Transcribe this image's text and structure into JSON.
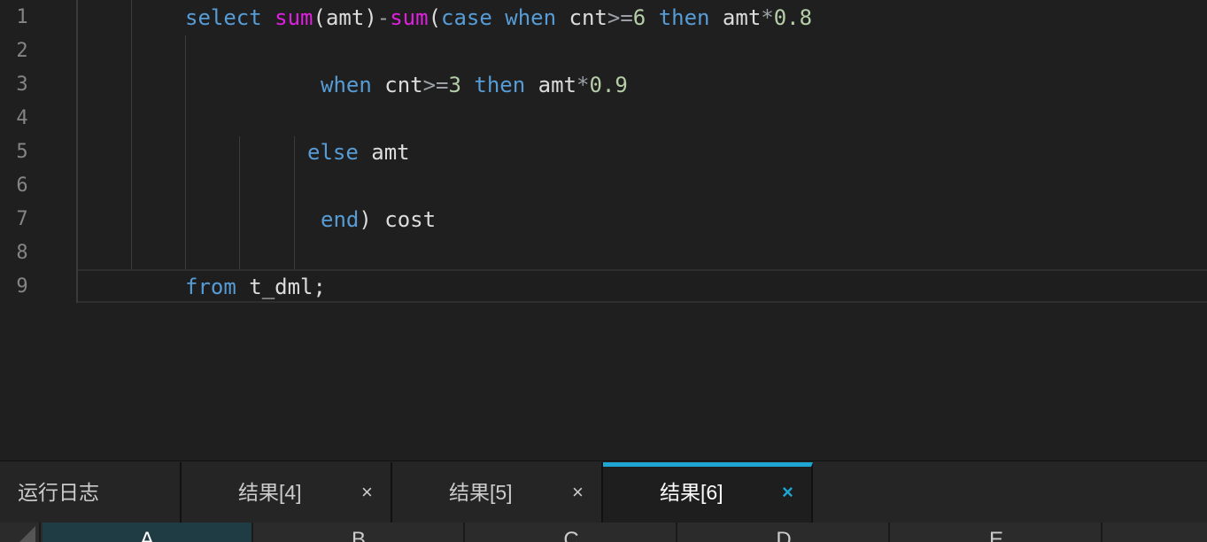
{
  "editor": {
    "line_numbers": [
      "1",
      "2",
      "3",
      "4",
      "5",
      "6",
      "7",
      "8",
      "9"
    ],
    "lines": [
      [
        {
          "t": "select",
          "c": "kw"
        },
        {
          "t": " ",
          "c": "plain"
        },
        {
          "t": "sum",
          "c": "fn"
        },
        {
          "t": "(amt)",
          "c": "plain"
        },
        {
          "t": "-",
          "c": "op"
        },
        {
          "t": "sum",
          "c": "fn"
        },
        {
          "t": "(",
          "c": "plain"
        },
        {
          "t": "case",
          "c": "kw"
        },
        {
          "t": " ",
          "c": "plain"
        },
        {
          "t": "when",
          "c": "kw"
        },
        {
          "t": " cnt",
          "c": "plain"
        },
        {
          "t": ">=",
          "c": "op"
        },
        {
          "t": "6",
          "c": "num"
        },
        {
          "t": " ",
          "c": "plain"
        },
        {
          "t": "then",
          "c": "kw"
        },
        {
          "t": " amt",
          "c": "plain"
        },
        {
          "t": "*",
          "c": "op"
        },
        {
          "t": "0.8",
          "c": "num"
        }
      ],
      [],
      [
        {
          "t": "when",
          "c": "kw"
        },
        {
          "t": " cnt",
          "c": "plain"
        },
        {
          "t": ">=",
          "c": "op"
        },
        {
          "t": "3",
          "c": "num"
        },
        {
          "t": " ",
          "c": "plain"
        },
        {
          "t": "then",
          "c": "kw"
        },
        {
          "t": " amt",
          "c": "plain"
        },
        {
          "t": "*",
          "c": "op"
        },
        {
          "t": "0.9",
          "c": "num"
        }
      ],
      [],
      [
        {
          "t": "else",
          "c": "kw"
        },
        {
          "t": " amt",
          "c": "plain"
        }
      ],
      [],
      [
        {
          "t": "end",
          "c": "kw"
        },
        {
          "t": ") cost",
          "c": "plain"
        }
      ],
      [],
      [
        {
          "t": "from",
          "c": "kw"
        },
        {
          "t": " t_dml;",
          "c": "plain"
        }
      ]
    ]
  },
  "tabs": {
    "log_label": "运行日志",
    "result4_label": "结果[4]",
    "result5_label": "结果[5]",
    "result6_label": "结果[6]",
    "close_glyph": "×"
  },
  "grid": {
    "columns": [
      "A",
      "B",
      "C",
      "D",
      "E"
    ]
  },
  "colors": {
    "keyword": "#569cd6",
    "function": "#e020e0",
    "number": "#b5cea8",
    "active_tab_accent": "#1ea5d4"
  }
}
